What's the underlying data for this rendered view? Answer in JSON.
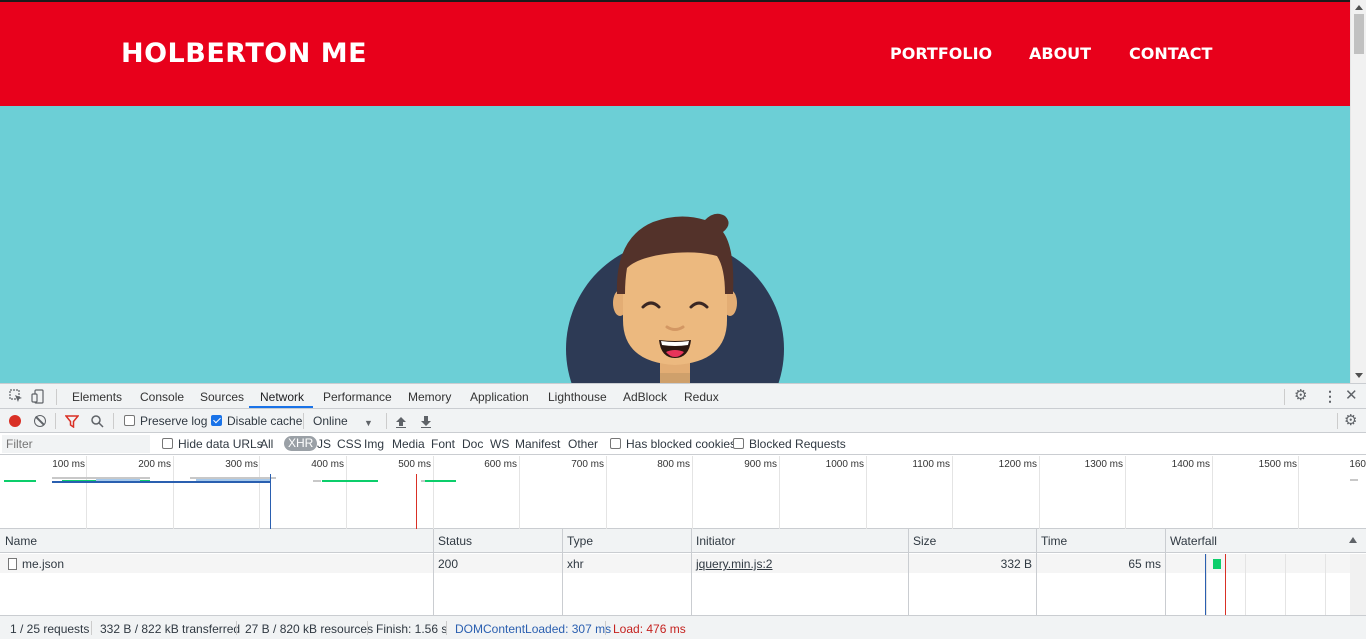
{
  "site": {
    "logo": "HOLBERTON ME",
    "nav": [
      "PORTFOLIO",
      "ABOUT",
      "CONTACT"
    ],
    "colors": {
      "header": "#e8001b",
      "hero": "#6ccfd6"
    }
  },
  "devtools": {
    "tabs": [
      "Elements",
      "Console",
      "Sources",
      "Network",
      "Performance",
      "Memory",
      "Application",
      "Lighthouse",
      "AdBlock",
      "Redux"
    ],
    "active_tab": "Network",
    "toolbar": {
      "preserve_log": "Preserve log",
      "disable_cache": "Disable cache",
      "throttling": "Online"
    },
    "filter": {
      "placeholder": "Filter",
      "hide_data_urls": "Hide data URLs",
      "types": [
        "All",
        "XHR",
        "JS",
        "CSS",
        "Img",
        "Media",
        "Font",
        "Doc",
        "WS",
        "Manifest",
        "Other"
      ],
      "selected_type": "XHR",
      "has_blocked_cookies": "Has blocked cookies",
      "blocked_requests": "Blocked Requests"
    },
    "timeline_ticks": [
      "100 ms",
      "200 ms",
      "300 ms",
      "400 ms",
      "500 ms",
      "600 ms",
      "700 ms",
      "800 ms",
      "900 ms",
      "1000 ms",
      "1100 ms",
      "1200 ms",
      "1300 ms",
      "1400 ms",
      "1500 ms",
      "160"
    ],
    "table": {
      "headers": [
        "Name",
        "Status",
        "Type",
        "Initiator",
        "Size",
        "Time",
        "Waterfall"
      ],
      "rows": [
        {
          "name": "me.json",
          "status": "200",
          "type": "xhr",
          "initiator": "jquery.min.js:2",
          "size": "332 B",
          "time": "65 ms"
        }
      ]
    },
    "status": {
      "requests": "1 / 25 requests",
      "transferred": "332 B / 822 kB transferred",
      "resources": "27 B / 820 kB resources",
      "finish": "Finish: 1.56 s",
      "dom_content_loaded": "DOMContentLoaded: 307 ms",
      "load": "Load: 476 ms"
    }
  }
}
